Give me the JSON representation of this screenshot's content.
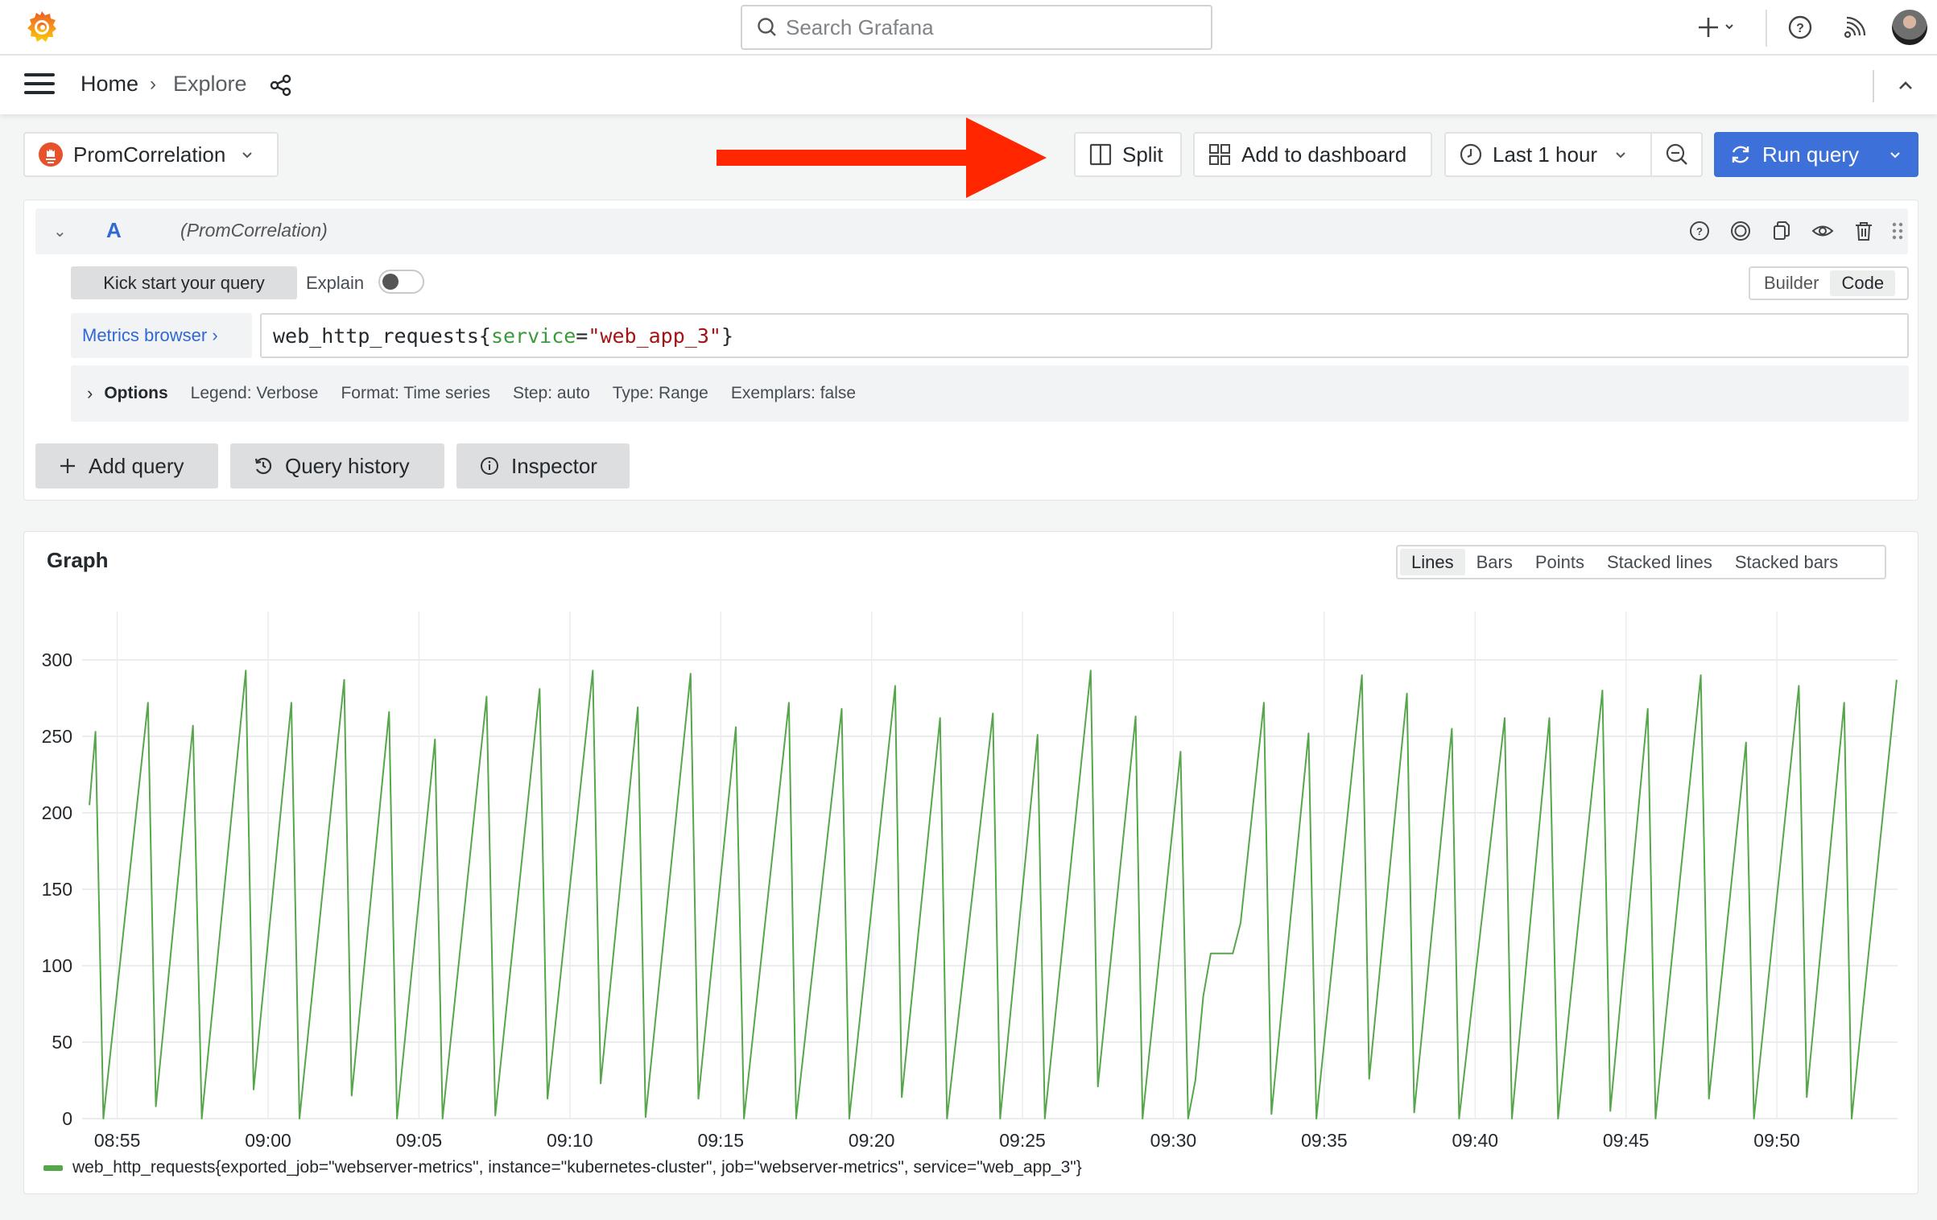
{
  "app": {
    "name": "Grafana"
  },
  "topbar": {
    "search_placeholder": "Search Grafana",
    "icons": [
      "grafana-logo",
      "plus-icon",
      "chevron-down-icon",
      "help-icon",
      "news-feed-icon",
      "user-avatar"
    ]
  },
  "breadcrumb": {
    "home": "Home",
    "separator": "›",
    "current": "Explore"
  },
  "toolbar": {
    "datasource": "PromCorrelation",
    "split_label": "Split",
    "add_to_dashboard_label": "Add to dashboard",
    "time_range_label": "Last 1 hour",
    "run_query_label": "Run query",
    "annotation_arrow_color": "#ff2600",
    "run_button_color": "#3d71d9"
  },
  "query": {
    "ref_id": "A",
    "datasource_label": "(PromCorrelation)",
    "kick_start_label": "Kick start your query",
    "explain_label": "Explain",
    "explain_enabled": false,
    "mode_options": [
      "Builder",
      "Code"
    ],
    "mode_selected": "Code",
    "metrics_browser_label": "Metrics browser ›",
    "expression": {
      "metric": "web_http_requests",
      "open": "{",
      "label_name": "service",
      "operator": "=",
      "label_value": "\"web_app_3\"",
      "close": "}"
    },
    "options": {
      "toggle_label": "Options",
      "legend": "Legend: Verbose",
      "format": "Format: Time series",
      "step": "Step: auto",
      "type": "Type: Range",
      "exemplars": "Exemplars: false"
    },
    "actions": {
      "add_query": "Add query",
      "query_history": "Query history",
      "inspector": "Inspector"
    }
  },
  "graph": {
    "title": "Graph",
    "view_options": [
      "Lines",
      "Bars",
      "Points",
      "Stacked lines",
      "Stacked bars"
    ],
    "view_selected": "Lines"
  },
  "chart_data": {
    "type": "line",
    "title": "Graph",
    "xlabel": "",
    "ylabel": "",
    "x_unit": "minutes after 08:55",
    "xlim": [
      -0.95,
      59.0
    ],
    "ylim": [
      0,
      300
    ],
    "grid": true,
    "x_ticks": [
      {
        "t": 0,
        "label": "08:55"
      },
      {
        "t": 5,
        "label": "09:00"
      },
      {
        "t": 10,
        "label": "09:05"
      },
      {
        "t": 15,
        "label": "09:10"
      },
      {
        "t": 20,
        "label": "09:15"
      },
      {
        "t": 25,
        "label": "09:20"
      },
      {
        "t": 30,
        "label": "09:25"
      },
      {
        "t": 35,
        "label": "09:30"
      },
      {
        "t": 40,
        "label": "09:35"
      },
      {
        "t": 45,
        "label": "09:40"
      },
      {
        "t": 50,
        "label": "09:45"
      },
      {
        "t": 55,
        "label": "09:50"
      }
    ],
    "y_ticks": [
      0,
      50,
      100,
      150,
      200,
      250,
      300
    ],
    "legend_position": "bottom-left",
    "series": [
      {
        "name": "web_http_requests{exported_job=\"webserver-metrics\", instance=\"kubernetes-cluster\", job=\"webserver-metrics\", service=\"web_app_3\"}",
        "color": "#56a64b",
        "x": [
          -0.92,
          -0.72,
          -0.46,
          1.02,
          1.28,
          2.51,
          2.8,
          4.26,
          4.52,
          5.77,
          6.04,
          7.52,
          7.77,
          9.01,
          9.27,
          10.53,
          10.78,
          12.24,
          12.53,
          14.0,
          14.26,
          15.76,
          16.02,
          17.25,
          17.51,
          19.0,
          19.26,
          20.5,
          20.77,
          22.26,
          22.5,
          24.01,
          24.26,
          25.78,
          26.0,
          27.27,
          27.5,
          29.02,
          29.26,
          30.5,
          30.74,
          32.26,
          32.5,
          33.75,
          33.98,
          35.24,
          35.49,
          35.73,
          35.99,
          36.24,
          36.97,
          37.23,
          38.0,
          38.25,
          39.48,
          39.74,
          41.25,
          41.49,
          42.74,
          42.98,
          44.23,
          44.47,
          45.98,
          46.22,
          47.46,
          47.75,
          49.22,
          49.48,
          50.72,
          50.98,
          52.48,
          52.75,
          53.98,
          54.24,
          55.73,
          55.99,
          57.23,
          57.48,
          58.97
        ],
        "values": [
          205,
          253,
          0,
          272,
          8,
          257,
          0,
          293,
          19,
          272,
          0,
          287,
          15,
          266,
          0,
          248,
          0,
          276,
          2,
          281,
          13,
          293,
          23,
          269,
          1,
          291,
          13,
          256,
          0,
          272,
          0,
          268,
          0,
          283,
          14,
          262,
          0,
          265,
          0,
          251,
          0,
          293,
          21,
          263,
          0,
          240,
          0,
          25,
          80,
          108,
          108,
          128,
          272,
          3,
          252,
          0,
          290,
          26,
          278,
          4,
          255,
          0,
          262,
          0,
          262,
          0,
          280,
          5,
          268,
          0,
          290,
          13,
          246,
          0,
          283,
          14,
          272,
          0,
          287
        ]
      }
    ]
  }
}
